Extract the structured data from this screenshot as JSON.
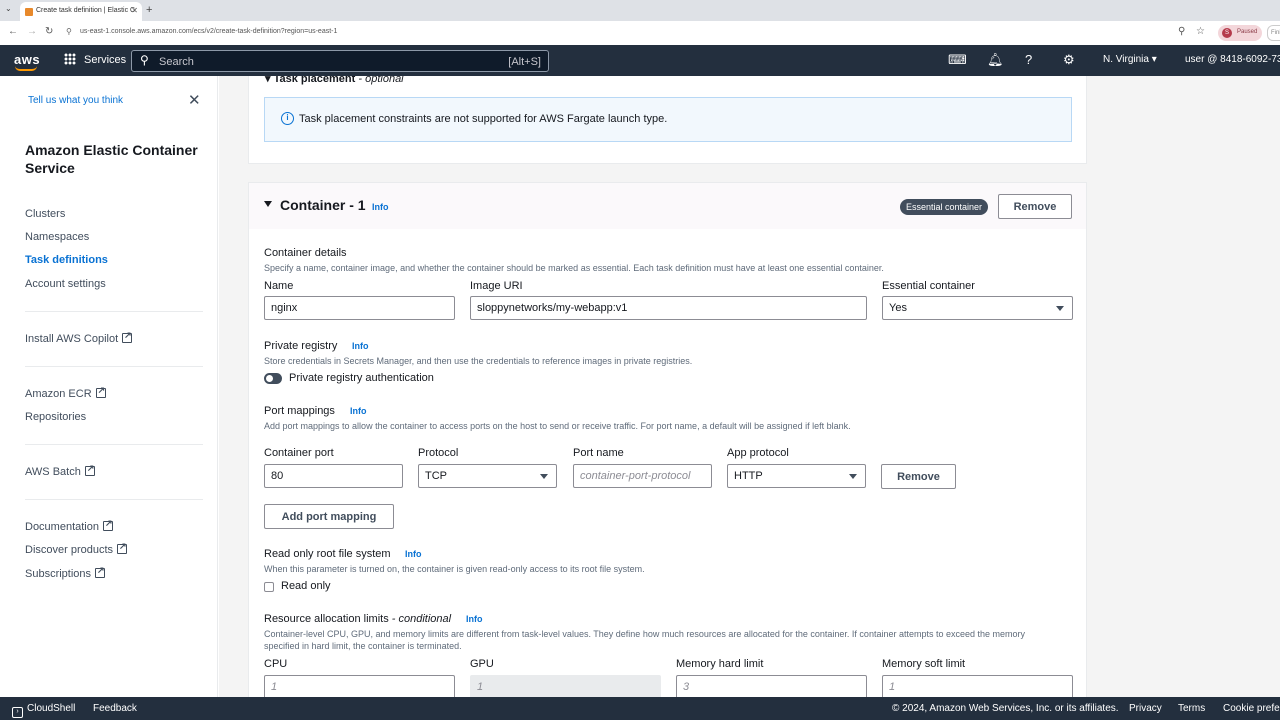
{
  "browser": {
    "tab_title": "Create task definition | Elastic C",
    "url": "us-east-1.console.aws.amazon.com/ecs/v2/create-task-definition?region=us-east-1",
    "profile_status": "Paused",
    "profile_initial": "S",
    "extra_chip": "Fini"
  },
  "topnav": {
    "logo": "aws",
    "services_label": "Services",
    "search_placeholder": "Search",
    "search_shortcut": "[Alt+S]",
    "region": "N. Virginia",
    "user": "user @ 8418-6092-73"
  },
  "sidebar": {
    "feedback": "Tell us what you think",
    "title": "Amazon Elastic Container Service",
    "nav": [
      {
        "label": "Clusters"
      },
      {
        "label": "Namespaces"
      },
      {
        "label": "Task definitions",
        "active": true
      },
      {
        "label": "Account settings"
      }
    ],
    "links": [
      {
        "label": "Install AWS Copilot"
      },
      {
        "label": "Amazon ECR"
      },
      {
        "label": "Repositories"
      },
      {
        "label": "AWS Batch"
      },
      {
        "label": "Documentation"
      },
      {
        "label": "Discover products"
      },
      {
        "label": "Subscriptions"
      }
    ]
  },
  "task_placement": {
    "heading": "Task placement",
    "heading_suffix": "- optional",
    "info_text": "Task placement constraints are not supported for AWS Fargate launch type."
  },
  "container": {
    "title": "Container - 1",
    "info": "Info",
    "badge": "Essential container",
    "remove_label": "Remove",
    "details": {
      "label": "Container details",
      "description": "Specify a name, container image, and whether the container should be marked as essential. Each task definition must have at least one essential container.",
      "name_label": "Name",
      "name_value": "nginx",
      "image_label": "Image URI",
      "image_value": "sloppynetworks/my-webapp:v1",
      "essential_label": "Essential container",
      "essential_value": "Yes"
    },
    "private_registry": {
      "label": "Private registry",
      "info": "Info",
      "description": "Store credentials in Secrets Manager, and then use the credentials to reference images in private registries.",
      "toggle_label": "Private registry authentication"
    },
    "port_mappings": {
      "label": "Port mappings",
      "info": "Info",
      "description": "Add port mappings to allow the container to access ports on the host to send or receive traffic. For port name, a default will be assigned if left blank.",
      "port_label": "Container port",
      "port_value": "80",
      "protocol_label": "Protocol",
      "protocol_value": "TCP",
      "name_label": "Port name",
      "name_placeholder": "container-port-protocol",
      "app_label": "App protocol",
      "app_value": "HTTP",
      "remove_label": "Remove",
      "add_label": "Add port mapping"
    },
    "read_only": {
      "label": "Read only root file system",
      "info": "Info",
      "description": "When this parameter is turned on, the container is given read-only access to its root file system.",
      "checkbox_label": "Read only"
    },
    "resources": {
      "label": "Resource allocation limits",
      "label_suffix": "- conditional",
      "info": "Info",
      "description_line1": "Container-level CPU, GPU, and memory limits are different from task-level values. They define how much resources are allocated for the container. If container attempts to exceed the memory",
      "description_line2": "specified in hard limit, the container is terminated.",
      "cpu_label": "CPU",
      "cpu_placeholder": "1",
      "gpu_label": "GPU",
      "gpu_placeholder": "1",
      "mem_hard_label": "Memory hard limit",
      "mem_hard_placeholder": "3",
      "mem_soft_label": "Memory soft limit",
      "mem_soft_placeholder": "1"
    }
  },
  "footer": {
    "cloudshell": "CloudShell",
    "feedback": "Feedback",
    "copyright": "© 2024, Amazon Web Services, Inc. or its affiliates.",
    "privacy": "Privacy",
    "terms": "Terms",
    "cookie": "Cookie preferences"
  }
}
